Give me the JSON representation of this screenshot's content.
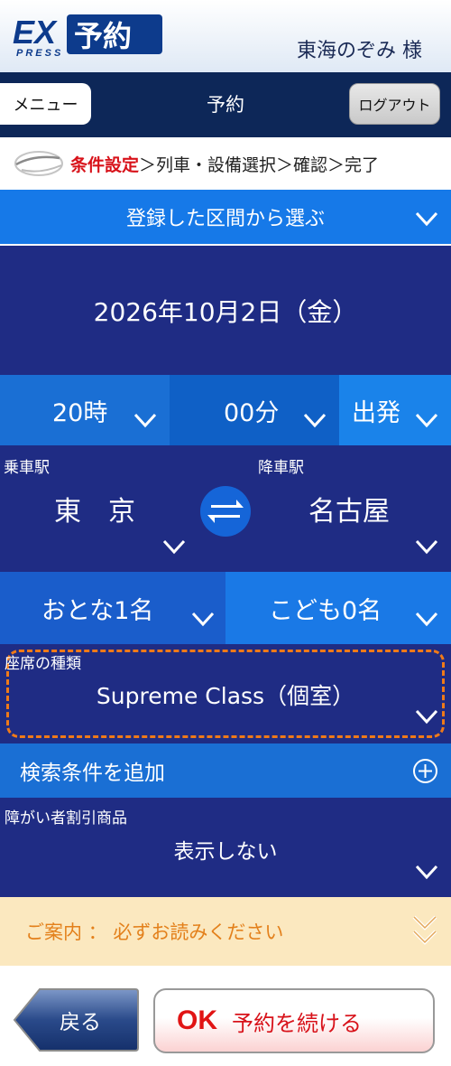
{
  "header": {
    "logo_text": "EX予約",
    "logo_sub": "PRESS",
    "user_name": "東海のぞみ 様"
  },
  "navbar": {
    "menu_label": "メニュー",
    "title": "予約",
    "logout_label": "ログアウト"
  },
  "steps": {
    "active": "条件設定",
    "rest": "＞列車・設備選択＞確認＞完了"
  },
  "saved_routes": {
    "label": "登録した区間から選ぶ"
  },
  "date": {
    "value": "2026年10月2日（金）"
  },
  "time": {
    "hour": "20時",
    "minute": "00分",
    "mode": "出発"
  },
  "stations": {
    "from_label": "乗車駅",
    "from": "東　京",
    "to_label": "降車駅",
    "to": "名古屋"
  },
  "passengers": {
    "adult": "おとな1名",
    "child": "こども0名"
  },
  "seat": {
    "label": "座席の種類",
    "value": "Supreme Class（個室）"
  },
  "search_options": {
    "label": "検索条件を追加"
  },
  "discount": {
    "label": "障がい者割引商品",
    "value": "表示しない"
  },
  "notice": {
    "label": "ご案内 ： 必ずお読みください"
  },
  "buttons": {
    "back_label": "戻る",
    "ok_word": "OK",
    "ok_label": "予約を続ける"
  },
  "colors": {
    "navy": "#0d2758",
    "panel": "#1f2c84",
    "accent_blue": "#1679e8",
    "highlight": "#f07a18",
    "active_step": "#d8121a"
  }
}
